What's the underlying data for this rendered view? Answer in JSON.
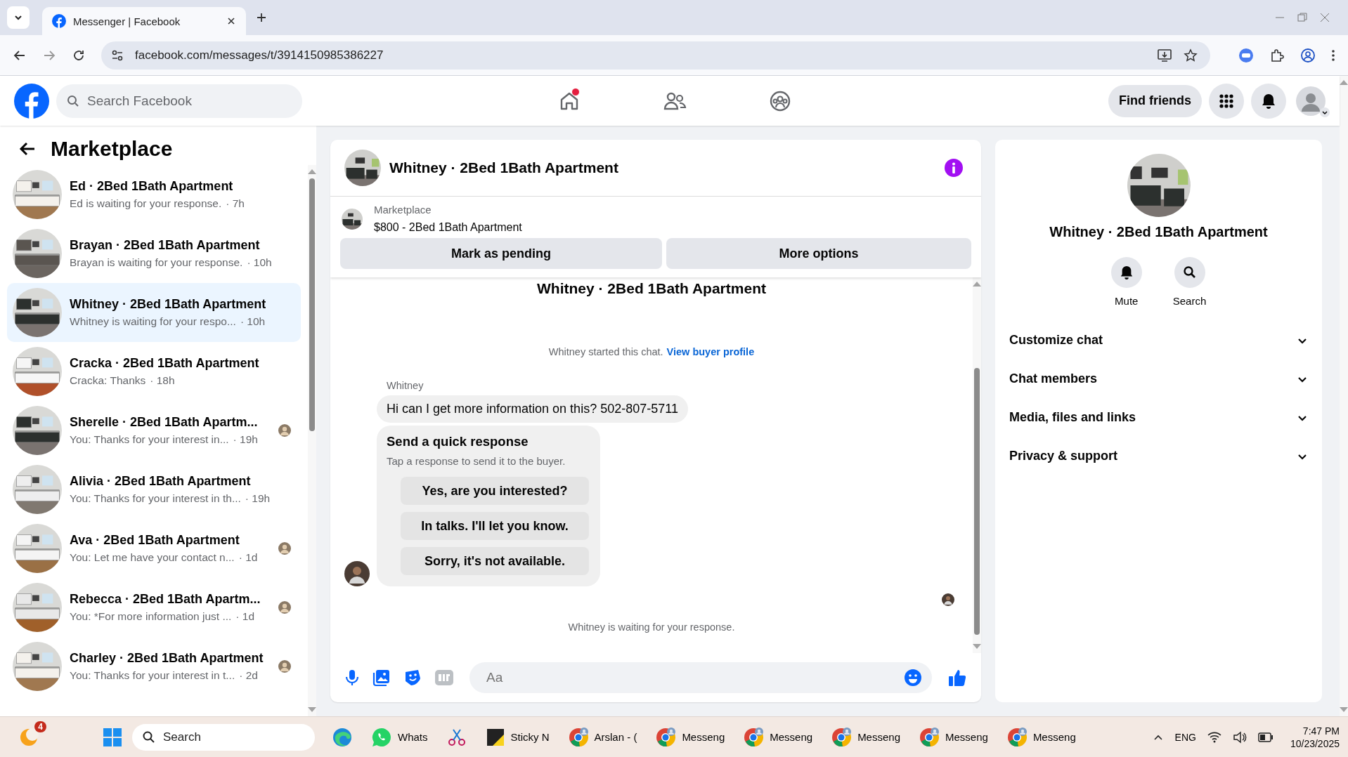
{
  "browser": {
    "tabs": [
      {
        "title": "Messenger | Facebook",
        "selected": true
      }
    ],
    "url": "facebook.com/messages/t/3914150985386227"
  },
  "topbar": {
    "search_placeholder": "Search Facebook",
    "home_notification": true,
    "find_friends": "Find friends"
  },
  "sidebar": {
    "title": "Marketplace",
    "conversations": [
      {
        "title": "Ed · 2Bed 1Bath Apartment",
        "preview": "Ed is waiting for your response.",
        "time": "· 7h",
        "selected": false,
        "seen_avatar": false
      },
      {
        "title": "Brayan · 2Bed 1Bath Apartment",
        "preview": "Brayan is waiting for your response.",
        "time": "· 10h",
        "selected": false,
        "seen_avatar": false
      },
      {
        "title": "Whitney · 2Bed 1Bath Apartment",
        "preview": "Whitney is waiting for your respo...",
        "time": "· 10h",
        "selected": true,
        "seen_avatar": false
      },
      {
        "title": "Cracka · 2Bed 1Bath Apartment",
        "preview": "Cracka: Thanks",
        "time": "· 18h",
        "selected": false,
        "seen_avatar": false
      },
      {
        "title": "Sherelle · 2Bed 1Bath Apartm...",
        "preview": "You: Thanks for your interest in...",
        "time": "· 19h",
        "selected": false,
        "seen_avatar": true
      },
      {
        "title": "Alivia · 2Bed 1Bath Apartment",
        "preview": "You: Thanks for your interest in th...",
        "time": "· 19h",
        "selected": false,
        "seen_avatar": false
      },
      {
        "title": "Ava · 2Bed 1Bath Apartment",
        "preview": "You: Let me have your contact n...",
        "time": "· 1d",
        "selected": false,
        "seen_avatar": true
      },
      {
        "title": "Rebecca · 2Bed 1Bath Apartm...",
        "preview": "You: *For more information just ...",
        "time": "· 1d",
        "selected": false,
        "seen_avatar": true
      },
      {
        "title": "Charley · 2Bed 1Bath Apartment",
        "preview": "You: Thanks for your interest in t...",
        "time": "· 2d",
        "selected": false,
        "seen_avatar": true
      }
    ]
  },
  "chat": {
    "title": "Whitney · 2Bed 1Bath Apartment",
    "listing_label": "Marketplace",
    "listing_title": "$800 - 2Bed 1Bath Apartment",
    "actions": [
      "Mark as pending",
      "More options"
    ],
    "scrolled_heading": "Whitney · 2Bed 1Bath Apartment",
    "started": "Whitney started this chat.",
    "profile_link": "View buyer profile",
    "sender": "Whitney",
    "message": "Hi can I get more information on this? 502-807-5711",
    "quick_response": {
      "title": "Send a quick response",
      "hint": "Tap a response to send it to the buyer.",
      "options": [
        "Yes, are you interested?",
        "In talks. I'll let you know.",
        "Sorry, it's not available."
      ]
    },
    "waiting": "Whitney is waiting for your response.",
    "composer_placeholder": "Aa"
  },
  "details": {
    "title": "Whitney · 2Bed 1Bath Apartment",
    "actions": [
      {
        "kind": "bell",
        "label": "Mute"
      },
      {
        "kind": "search",
        "label": "Search"
      }
    ],
    "sections": [
      "Customize chat",
      "Chat members",
      "Media, files and links",
      "Privacy & support"
    ]
  },
  "taskbar": {
    "badge": "4",
    "search_placeholder": "Search",
    "apps": [
      {
        "kind": "edge"
      },
      {
        "kind": "whatsapp",
        "label": "Whats"
      },
      {
        "kind": "snip"
      },
      {
        "kind": "sticky",
        "label": "Sticky N"
      },
      {
        "kind": "chrome",
        "label": "Arslan - ("
      },
      {
        "kind": "chrome",
        "label": "Messeng"
      },
      {
        "kind": "chrome",
        "label": "Messeng"
      },
      {
        "kind": "chrome",
        "label": "Messeng"
      },
      {
        "kind": "chrome",
        "label": "Messeng"
      },
      {
        "kind": "chrome",
        "label": "Messeng"
      }
    ],
    "language": "ENG",
    "time": "7:47 PM",
    "date": "10/23/2025"
  }
}
